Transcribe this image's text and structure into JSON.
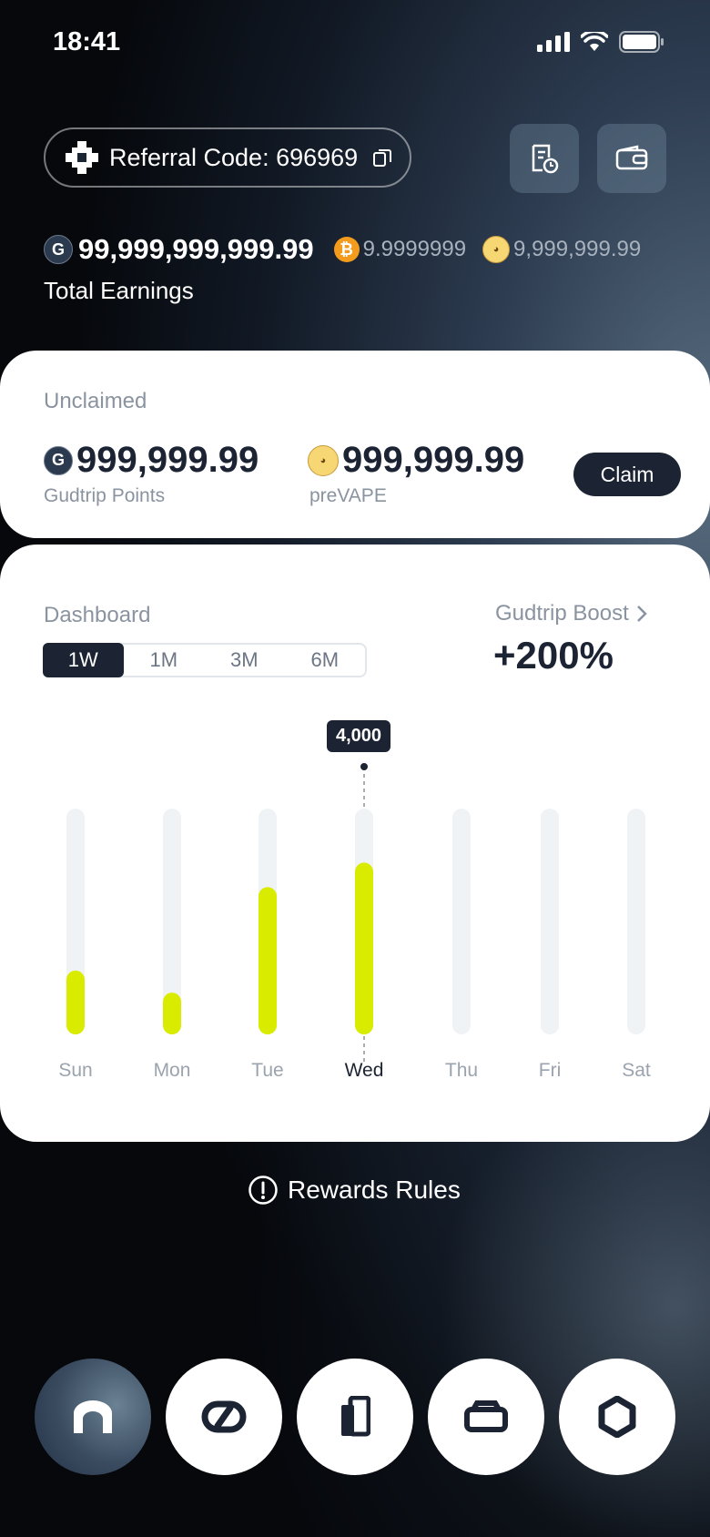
{
  "status": {
    "time": "18:41"
  },
  "header": {
    "referral_label": "Referral Code: 696969",
    "buttons": [
      "history",
      "wallet"
    ]
  },
  "earnings": {
    "main_value": "99,999,999,999.99",
    "btc_value": "9.9999999",
    "prevape_value": "9,999,999.99",
    "label": "Total Earnings"
  },
  "unclaimed": {
    "title": "Unclaimed",
    "points_value": "999,999.99",
    "points_label": "Gudtrip Points",
    "prevape_value": "999,999.99",
    "prevape_label": "preVAPE",
    "claim_label": "Claim"
  },
  "dashboard": {
    "title": "Dashboard",
    "ranges": [
      "1W",
      "1M",
      "3M",
      "6M"
    ],
    "active_range": "1W",
    "boost_label": "Gudtrip Boost",
    "boost_value": "+200%"
  },
  "chart_data": {
    "type": "bar",
    "categories": [
      "Sun",
      "Mon",
      "Tue",
      "Wed",
      "Thu",
      "Fri",
      "Sat"
    ],
    "values": [
      1300,
      850,
      3000,
      3500,
      0,
      0,
      0
    ],
    "max": 4600,
    "selected": "Wed",
    "tooltip": "4,000",
    "accent": "#d9ec00",
    "track": "#f0f3f6"
  },
  "rules_label": "Rewards Rules",
  "nav": [
    "home",
    "link",
    "device",
    "store",
    "settings"
  ],
  "active_nav": "home"
}
